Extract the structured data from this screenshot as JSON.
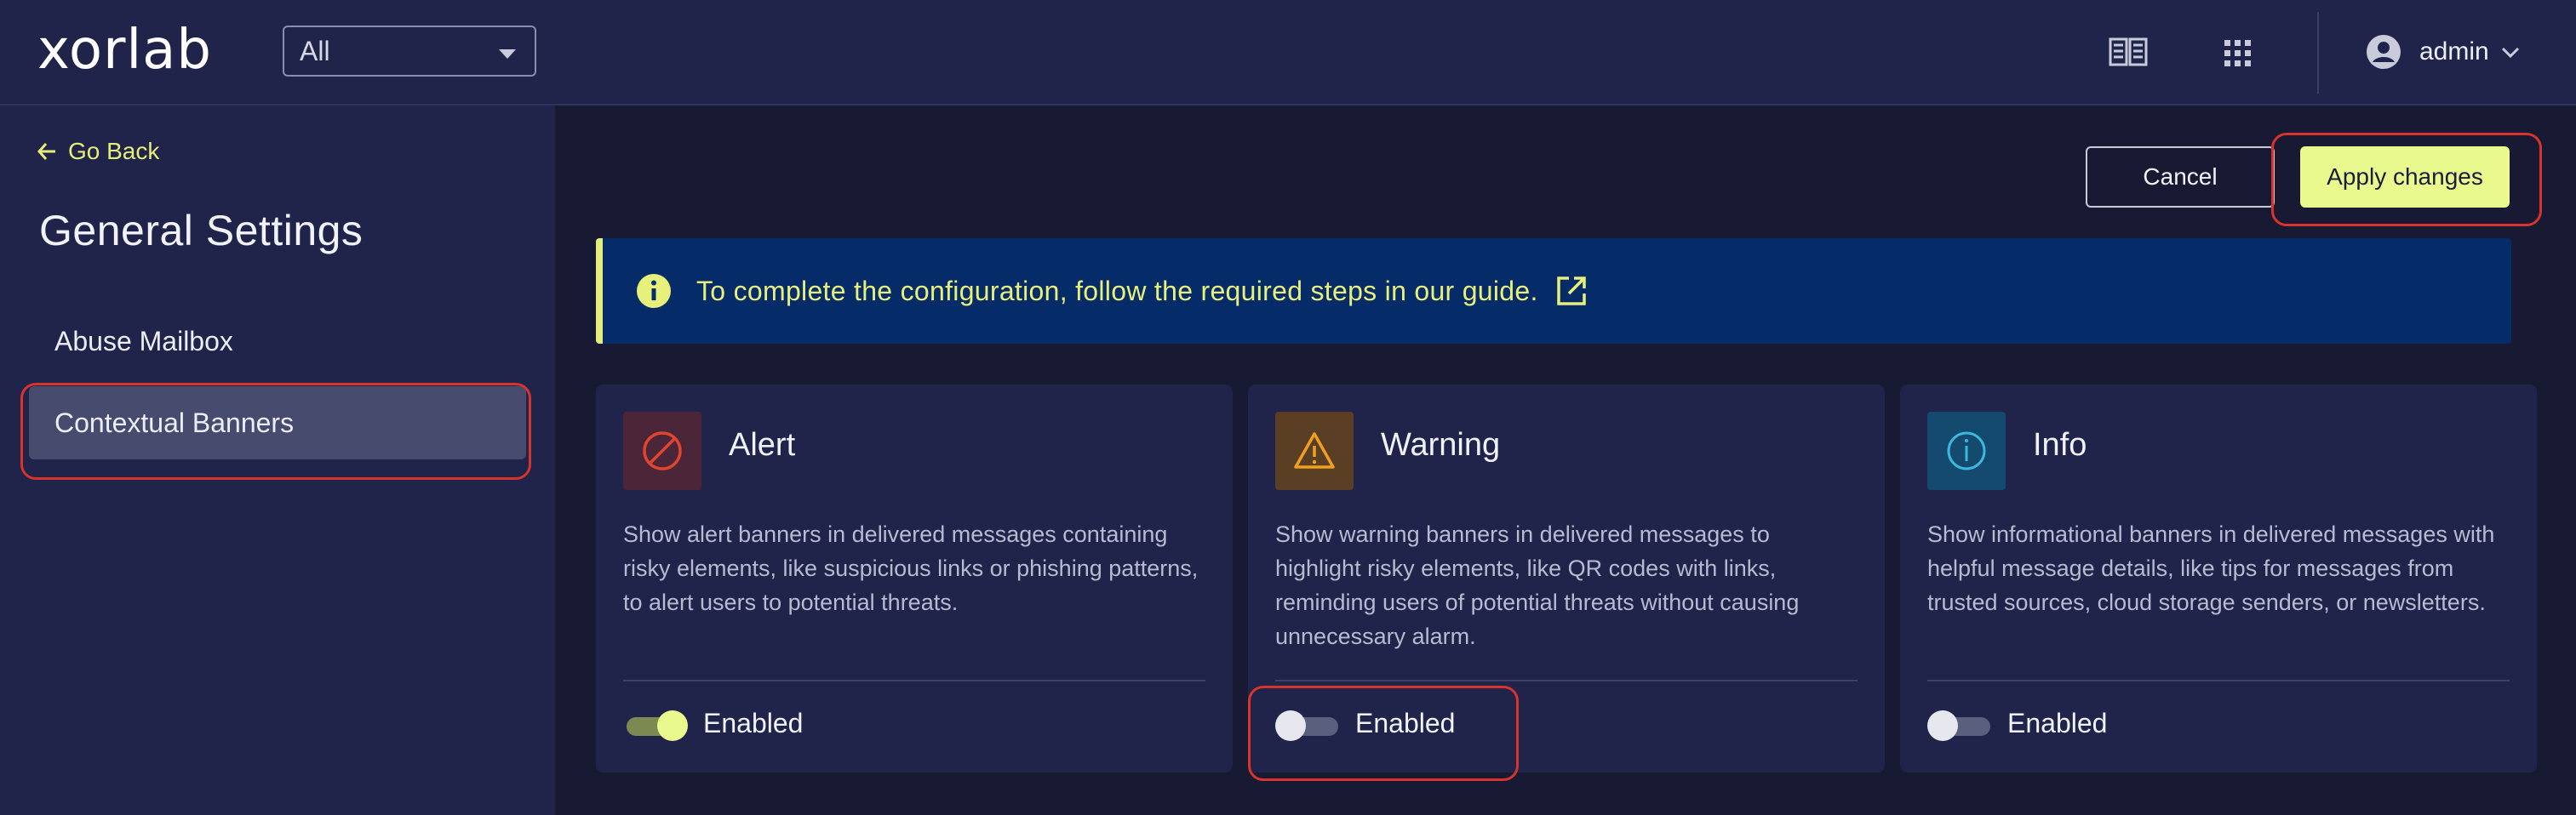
{
  "header": {
    "logo_text": "xorlab",
    "scope_select": {
      "value": "All"
    },
    "icons": {
      "docs": "book-icon",
      "apps": "grid-icon",
      "user": "user-circle-icon"
    },
    "user": {
      "name": "admin"
    }
  },
  "sidebar": {
    "go_back": "Go Back",
    "title": "General Settings",
    "items": [
      {
        "label": "Abuse Mailbox",
        "active": false
      },
      {
        "label": "Contextual Banners",
        "active": true
      }
    ]
  },
  "actions": {
    "cancel": "Cancel",
    "apply": "Apply changes"
  },
  "notice": {
    "text": "To complete the configuration, follow the required steps in our guide.",
    "icon": "info-icon",
    "link_icon": "external-link-icon"
  },
  "cards": [
    {
      "title": "Alert",
      "icon": "prohibited-icon",
      "accent": "#e0452f",
      "tile_bg": "#4b2538",
      "description": "Show alert banners in delivered messages containing risky elements, like suspicious links or phishing patterns, to alert users to potential threats.",
      "toggle_label": "Enabled",
      "toggle_on": true
    },
    {
      "title": "Warning",
      "icon": "warning-triangle-icon",
      "accent": "#f0a020",
      "tile_bg": "#5a3f24",
      "description": "Show warning banners in delivered messages to highlight risky elements, like QR codes with links, reminding users of potential threats without causing unnecessary alarm.",
      "toggle_label": "Enabled",
      "toggle_on": false
    },
    {
      "title": "Info",
      "icon": "info-circle-icon",
      "accent": "#3cb8e0",
      "tile_bg": "#134a6e",
      "description": "Show informational banners in delivered messages with helpful message details, like tips for messages from trusted sources, cloud storage senders, or newsletters.",
      "toggle_label": "Enabled",
      "toggle_on": false
    }
  ],
  "colors": {
    "accent": "#eaf98e",
    "highlight": "#d8342b",
    "background": "#181a33",
    "panel": "#20244a"
  }
}
